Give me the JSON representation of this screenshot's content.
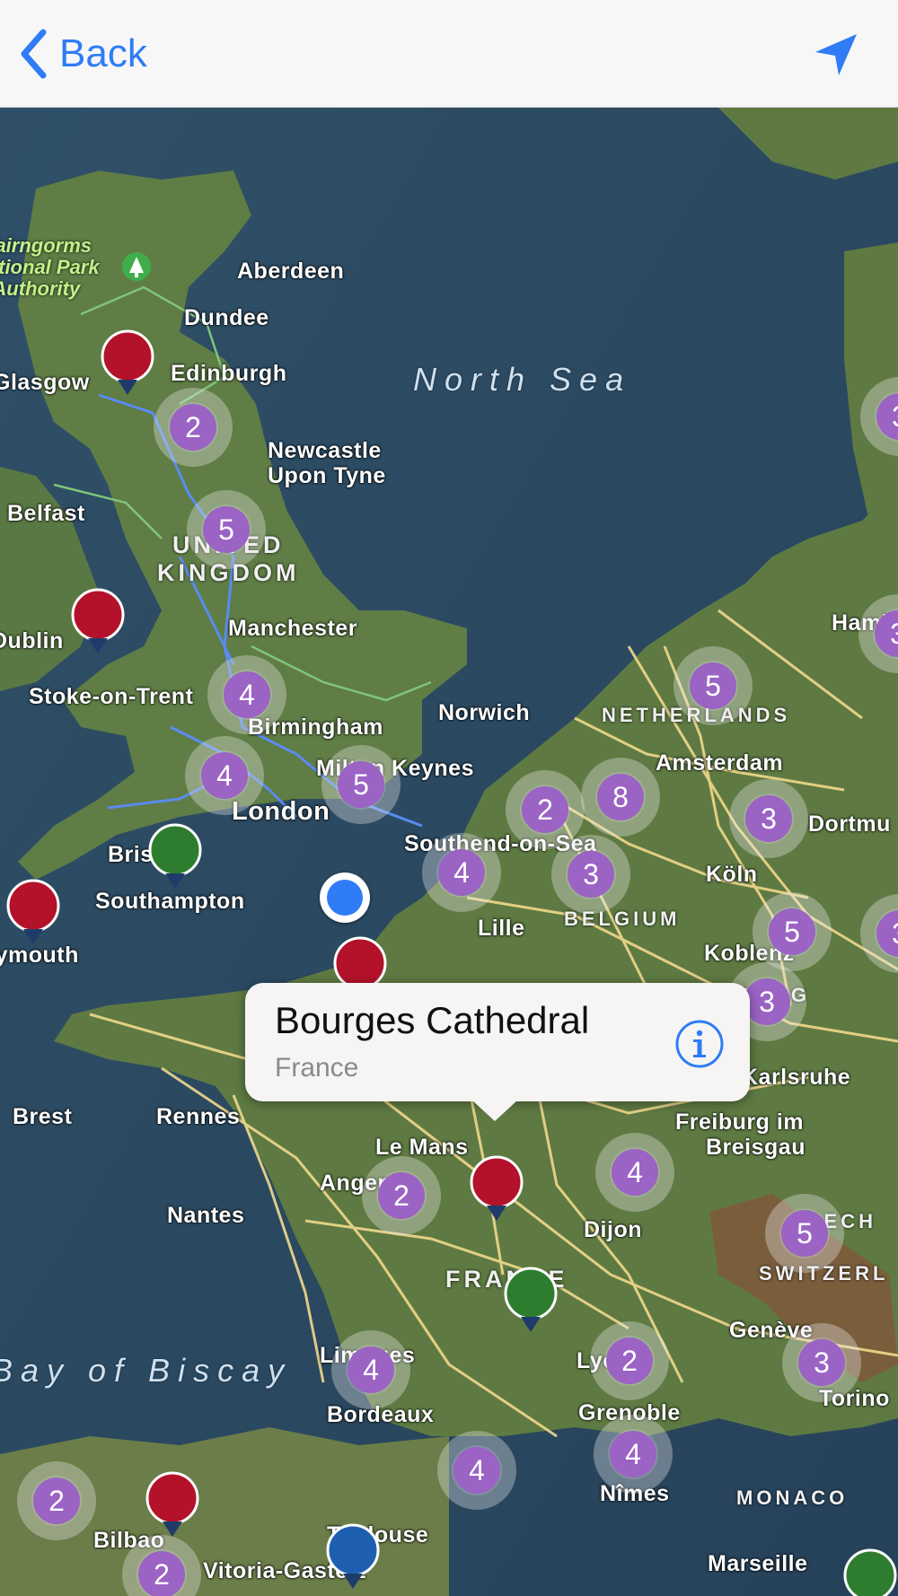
{
  "nav": {
    "back_label": "Back",
    "back_icon": "chevron-left-icon",
    "location_icon": "location-arrow-icon",
    "accent_color": "#2f7cf6"
  },
  "map": {
    "seas": [
      "North Sea",
      "Bay of Biscay"
    ],
    "countries": {
      "uk_line1": "UNITED",
      "uk_line2": "KINGDOM",
      "netherlands": "NETHERLANDS",
      "belgium": "BELGIUM",
      "france": "FRANCE",
      "switzerland": "SWITZERL",
      "monaco": "MONACO",
      "liech": "LIECH",
      "lux": "OURG"
    },
    "park": {
      "line1": "Cairngorms",
      "line2": "National Park",
      "line3": "Authority"
    },
    "cities": {
      "aberdeen": "Aberdeen",
      "dundee": "Dundee",
      "glasgow": "Glasgow",
      "edinburgh": "Edinburgh",
      "newcastle1": "Newcastle",
      "newcastle2": "Upon Tyne",
      "belfast": "Belfast",
      "dublin": "Dublin",
      "manchester": "Manchester",
      "stoke": "Stoke-on-Trent",
      "norwich": "Norwich",
      "birmingham": "Birmingham",
      "milton_keynes": "Milton Keynes",
      "london": "London",
      "bristol": "Bristol",
      "southend": "Southend-on-Sea",
      "southampton": "Southampton",
      "plymouth": "Plymouth",
      "amsterdam": "Amsterdam",
      "dortmund": "Dortmu",
      "koln": "Köln",
      "lille": "Lille",
      "koblenz": "Koblenz",
      "hamburg": "Hamb",
      "karlsruhe": "Karlsruhe",
      "brest": "Brest",
      "rennes": "Rennes",
      "le_mans": "Le Mans",
      "angers": "Angers",
      "nantes": "Nantes",
      "dijon": "Dijon",
      "freiburg1": "Freiburg im",
      "freiburg2": "Breisgau",
      "limoges": "Limoges",
      "geneve": "Genève",
      "lyon": "Lyon",
      "bordeaux": "Bordeaux",
      "grenoble": "Grenoble",
      "torino": "Torino",
      "nimes": "Nîmes",
      "bilbao": "Bilbao",
      "toulouse": "Toulouse",
      "vitoria": "Vitoria-Gasteiz",
      "marseille": "Marseille"
    },
    "clusters": [
      "2",
      "5",
      "4",
      "4",
      "5",
      "4",
      "2",
      "8",
      "3",
      "5",
      "3",
      "3",
      "5",
      "3",
      "2",
      "4",
      "4",
      "5",
      "3",
      "4",
      "2",
      "4",
      "2",
      "2",
      "3",
      "3"
    ],
    "colors": {
      "red_pin": "#b3122a",
      "green_pin": "#2e7d2e",
      "blue_pin": "#1f5fb0",
      "cluster": "#9a63c4",
      "water": "#2c4a5e",
      "land": "#5d7b48",
      "road": "#f1d98c"
    }
  },
  "callout": {
    "title": "Bourges Cathedral",
    "subtitle": "France",
    "info_icon": "info-icon"
  }
}
